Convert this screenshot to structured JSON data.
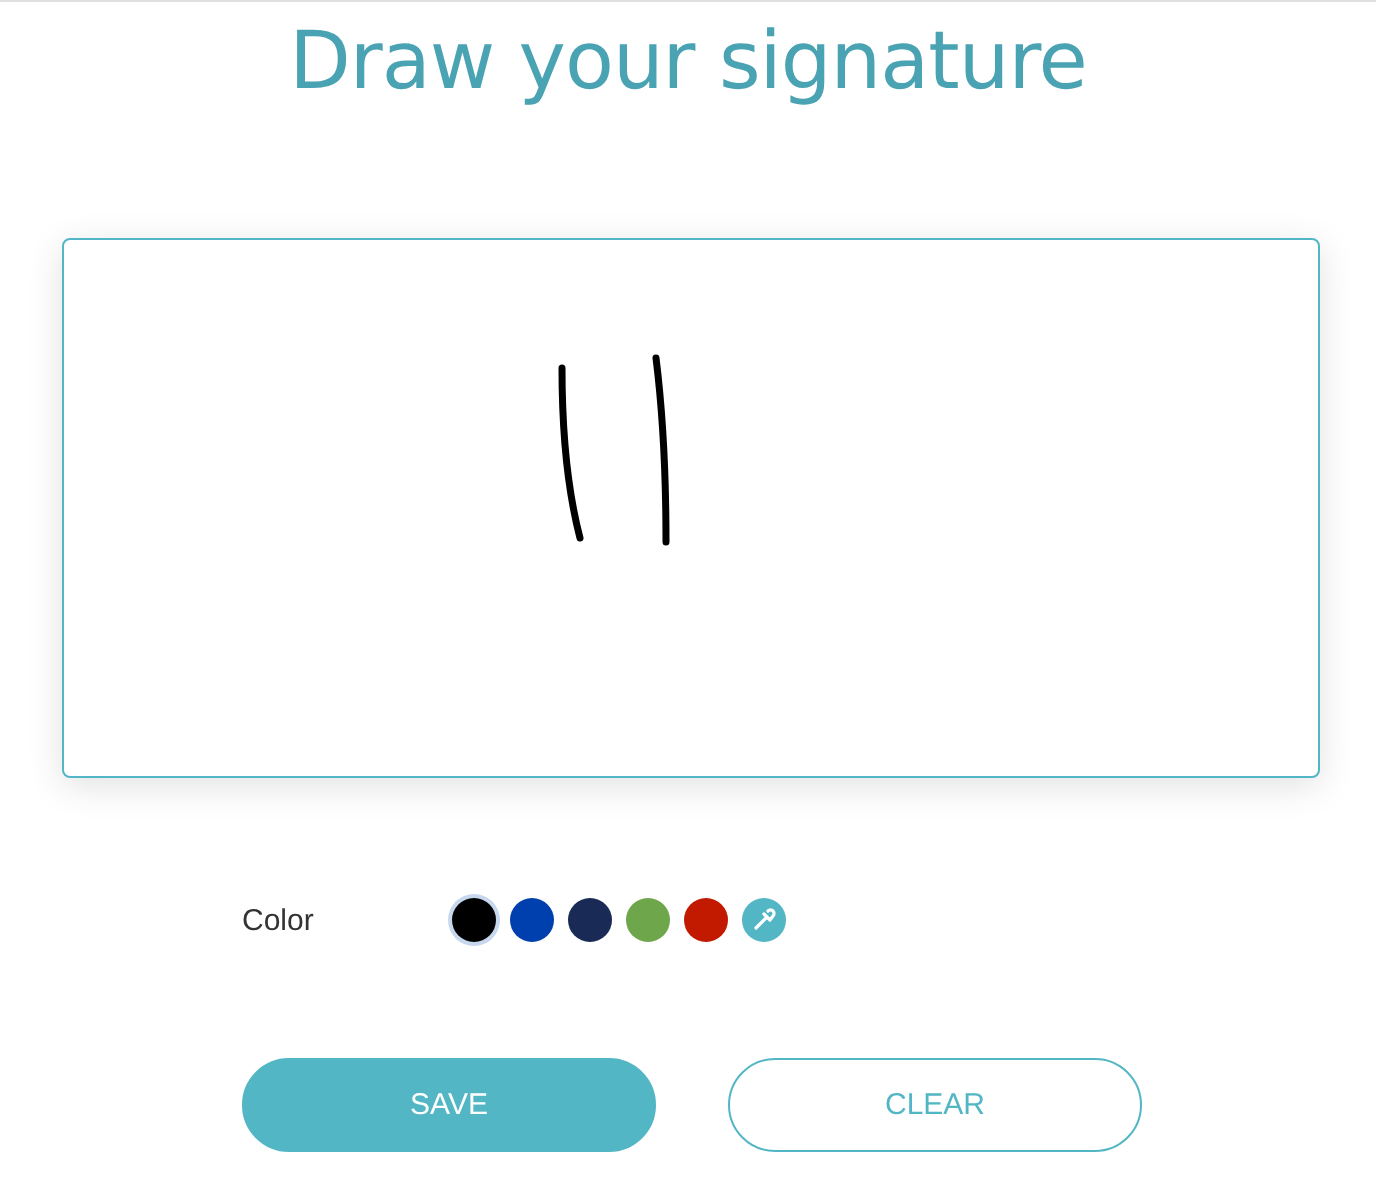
{
  "title": "Draw your signature",
  "color_label": "Color",
  "swatches": [
    {
      "kind": "color",
      "color": "#000000",
      "selected": true
    },
    {
      "kind": "color",
      "color": "#003fae",
      "selected": false
    },
    {
      "kind": "color",
      "color": "#1a2a56",
      "selected": false
    },
    {
      "kind": "color",
      "color": "#6ea64c",
      "selected": false
    },
    {
      "kind": "color",
      "color": "#c21a00",
      "selected": false
    },
    {
      "kind": "picker",
      "color": "#52b6c5",
      "selected": false
    }
  ],
  "buttons": [
    {
      "kind": "primary",
      "label": "SAVE"
    },
    {
      "kind": "secondary",
      "label": "CLEAR"
    }
  ]
}
